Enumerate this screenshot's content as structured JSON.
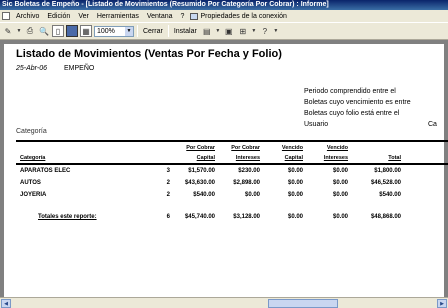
{
  "window": {
    "title": "Sic Boletas de Empeño - [Listado de Movimientos (Resumido Por Categoría Por Cobrar) : Informe]"
  },
  "menu": {
    "items": [
      "Archivo",
      "Edición",
      "Ver",
      "Herramientas",
      "Ventana",
      "?"
    ],
    "properties": "Propiedades de la conexión"
  },
  "toolbar": {
    "zoom": "100%",
    "close_label": "Cerrar",
    "install_label": "Instalar"
  },
  "report": {
    "title": "Listado de Movimientos (Ventas Por Fecha y Folio)",
    "date": "25-Abr-06",
    "subtitle": "EMPEÑO",
    "category_label": "Categoría",
    "notes": [
      "Periodo comprendido entre el",
      "Boletas cuyo vencimiento es entre",
      "Boletas cuyo folio está entre el",
      "Usuario"
    ],
    "truncated_right": "Ca",
    "headers": {
      "category": "Categoría",
      "por_cobrar_capital": [
        "Por Cobrar",
        "Capital"
      ],
      "por_cobrar_intereses": [
        "Por Cobrar",
        "Intereses"
      ],
      "vencido_capital": [
        "Vencido",
        "Capital"
      ],
      "vencido_intereses": [
        "Vencido",
        "Intereses"
      ],
      "total": "Total"
    },
    "rows": [
      {
        "category": "APARATOS ELEC",
        "count": "3",
        "cap": "$1,570.00",
        "int": "$230.00",
        "vcap": "$0.00",
        "vint": "$0.00",
        "total": "$1,800.00"
      },
      {
        "category": "AUTOS",
        "count": "2",
        "cap": "$43,630.00",
        "int": "$2,898.00",
        "vcap": "$0.00",
        "vint": "$0.00",
        "total": "$46,528.00"
      },
      {
        "category": "JOYERIA",
        "count": "2",
        "cap": "$540.00",
        "int": "$0.00",
        "vcap": "$0.00",
        "vint": "$0.00",
        "total": "$540.00"
      }
    ],
    "totals": {
      "label": "Totales este reporte:",
      "count": "6",
      "cap": "$45,740.00",
      "int": "$3,128.00",
      "vcap": "$0.00",
      "vint": "$0.00",
      "total": "$48,868.00"
    }
  }
}
